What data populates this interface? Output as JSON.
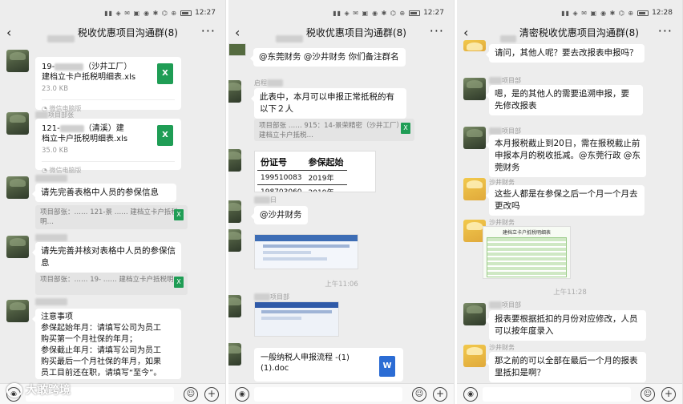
{
  "status": {
    "time1": "12:27",
    "time2": "12:27",
    "time3": "12:28"
  },
  "p1": {
    "title": "税收优惠项目沟通群(8)",
    "file1": {
      "name_a": "19-",
      "name_b": "（沙井工厂）",
      "name_c": "建档立卡户抵税明细表.xls",
      "size": "23.0 KB",
      "source": "微信电脑版",
      "icon": "X"
    },
    "nick1": "项目部张",
    "file2": {
      "name_a": "121-",
      "name_b": "（清溪）建",
      "name_c": "档立卡户抵税明细表.xls",
      "size": "35.0 KB",
      "source": "微信电脑版",
      "icon": "X"
    },
    "msg1": "请先完善表格中人员的参保信息",
    "quote1": "项目部张：…… 121-景 …… 建档立卡户抵税明…",
    "msg2": "请先完善并核对表格中人员的参保信息",
    "quote2": "项目部张：…… 19- …… 建档立卡户抵税明…",
    "notice": [
      "注意事项",
      "参保起始年月：请填写公司为员工",
      "购买第一个月社保的年月；",
      "参保截止年月：请填写公司为员工",
      "购买最后一个月社保的年月，如果",
      "员工目前还在职，请填写“至今”。"
    ],
    "watermark": "大敢跨境"
  },
  "p2": {
    "title": "税收优惠项目沟通群(8)",
    "msg1": "@东莞财务 @沙井财务 你们备注群名",
    "nick1": "启程",
    "msg2": "此表中，本月可以申报正常抵税的有以下２人",
    "quote1": "项目部张 …… 915：14-景荣精密（沙井工厂）建档立卡户抵税…",
    "table": {
      "h1": "份证号",
      "h2": "参保起始",
      "r1c1": "199510083",
      "r1c2": "2019年",
      "r2c1": "198703060",
      "r2c2": "2019年"
    },
    "nick2": "日",
    "msg3": "@沙井财务",
    "time": "上午11:06",
    "nick3": "项目部",
    "file": {
      "name": "一般纳税人申报流程 -(1)(1).doc",
      "icon": "W"
    }
  },
  "p3": {
    "title": "清密税收优惠项目沟通群(8)",
    "msg1": "请问，其他人呢？要去改报表申报吗？",
    "nick1": "项目部",
    "msg2": "嗯，是的其他人的需要追溯申报，要先修改报表",
    "nick2": "项目部",
    "msg3": "本月报税截止到20日，需在报税截止前申报本月的税收抵减。@东莞行政 @东莞财务",
    "nick3": "沙井财务",
    "msg4": "这些人都是在参保之后一个月一个月去更改吗",
    "nick4": "沙井财务",
    "sheet_title": "建档立卡户抵税明细表",
    "time": "上午11:28",
    "nick5": "项目部",
    "msg5": "报表要根据抵扣的月份对应修改，人员可以按年度录入",
    "nick6": "沙井财务",
    "msg6": "那之前的可以全部在最后一个月的报表里抵扣是啊？"
  }
}
